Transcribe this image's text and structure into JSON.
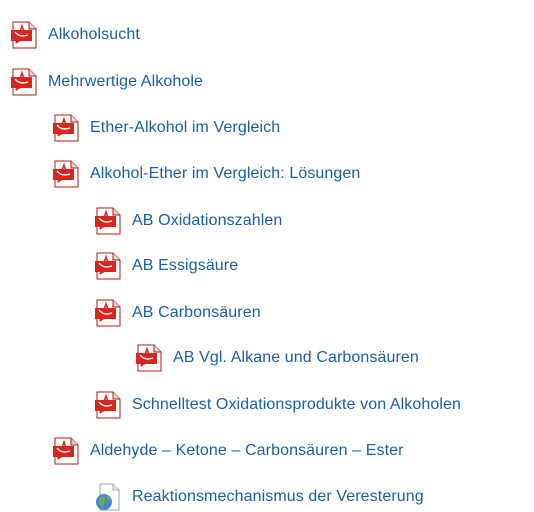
{
  "items": [
    {
      "label": "Alkoholsucht",
      "icon": "pdf-icon"
    },
    {
      "label": "Mehrwertige Alkohole",
      "icon": "pdf-icon"
    },
    {
      "label": "Ether-Alkohol im Vergleich",
      "icon": "pdf-icon"
    },
    {
      "label": "Alkohol-Ether im Vergleich: Lösungen",
      "icon": "pdf-icon"
    },
    {
      "label": "AB Oxidationszahlen",
      "icon": "pdf-icon"
    },
    {
      "label": "AB Essigsäure",
      "icon": "pdf-icon"
    },
    {
      "label": "AB Carbonsäuren",
      "icon": "pdf-icon"
    },
    {
      "label": "AB Vgl. Alkane und Carbonsäuren",
      "icon": "pdf-icon"
    },
    {
      "label": "Schnelltest Oxidationsprodukte von Alkoholen",
      "icon": "pdf-icon"
    },
    {
      "label": "Aldehyde – Ketone – Carbonsäuren – Ester",
      "icon": "pdf-icon"
    },
    {
      "label": "Reaktionsmechanismus der Veresterung",
      "icon": "web-link-icon"
    }
  ],
  "colors": {
    "link": "#1a5fa6",
    "pdf_red": "#d8261f",
    "page_bg": "#ffffff"
  }
}
